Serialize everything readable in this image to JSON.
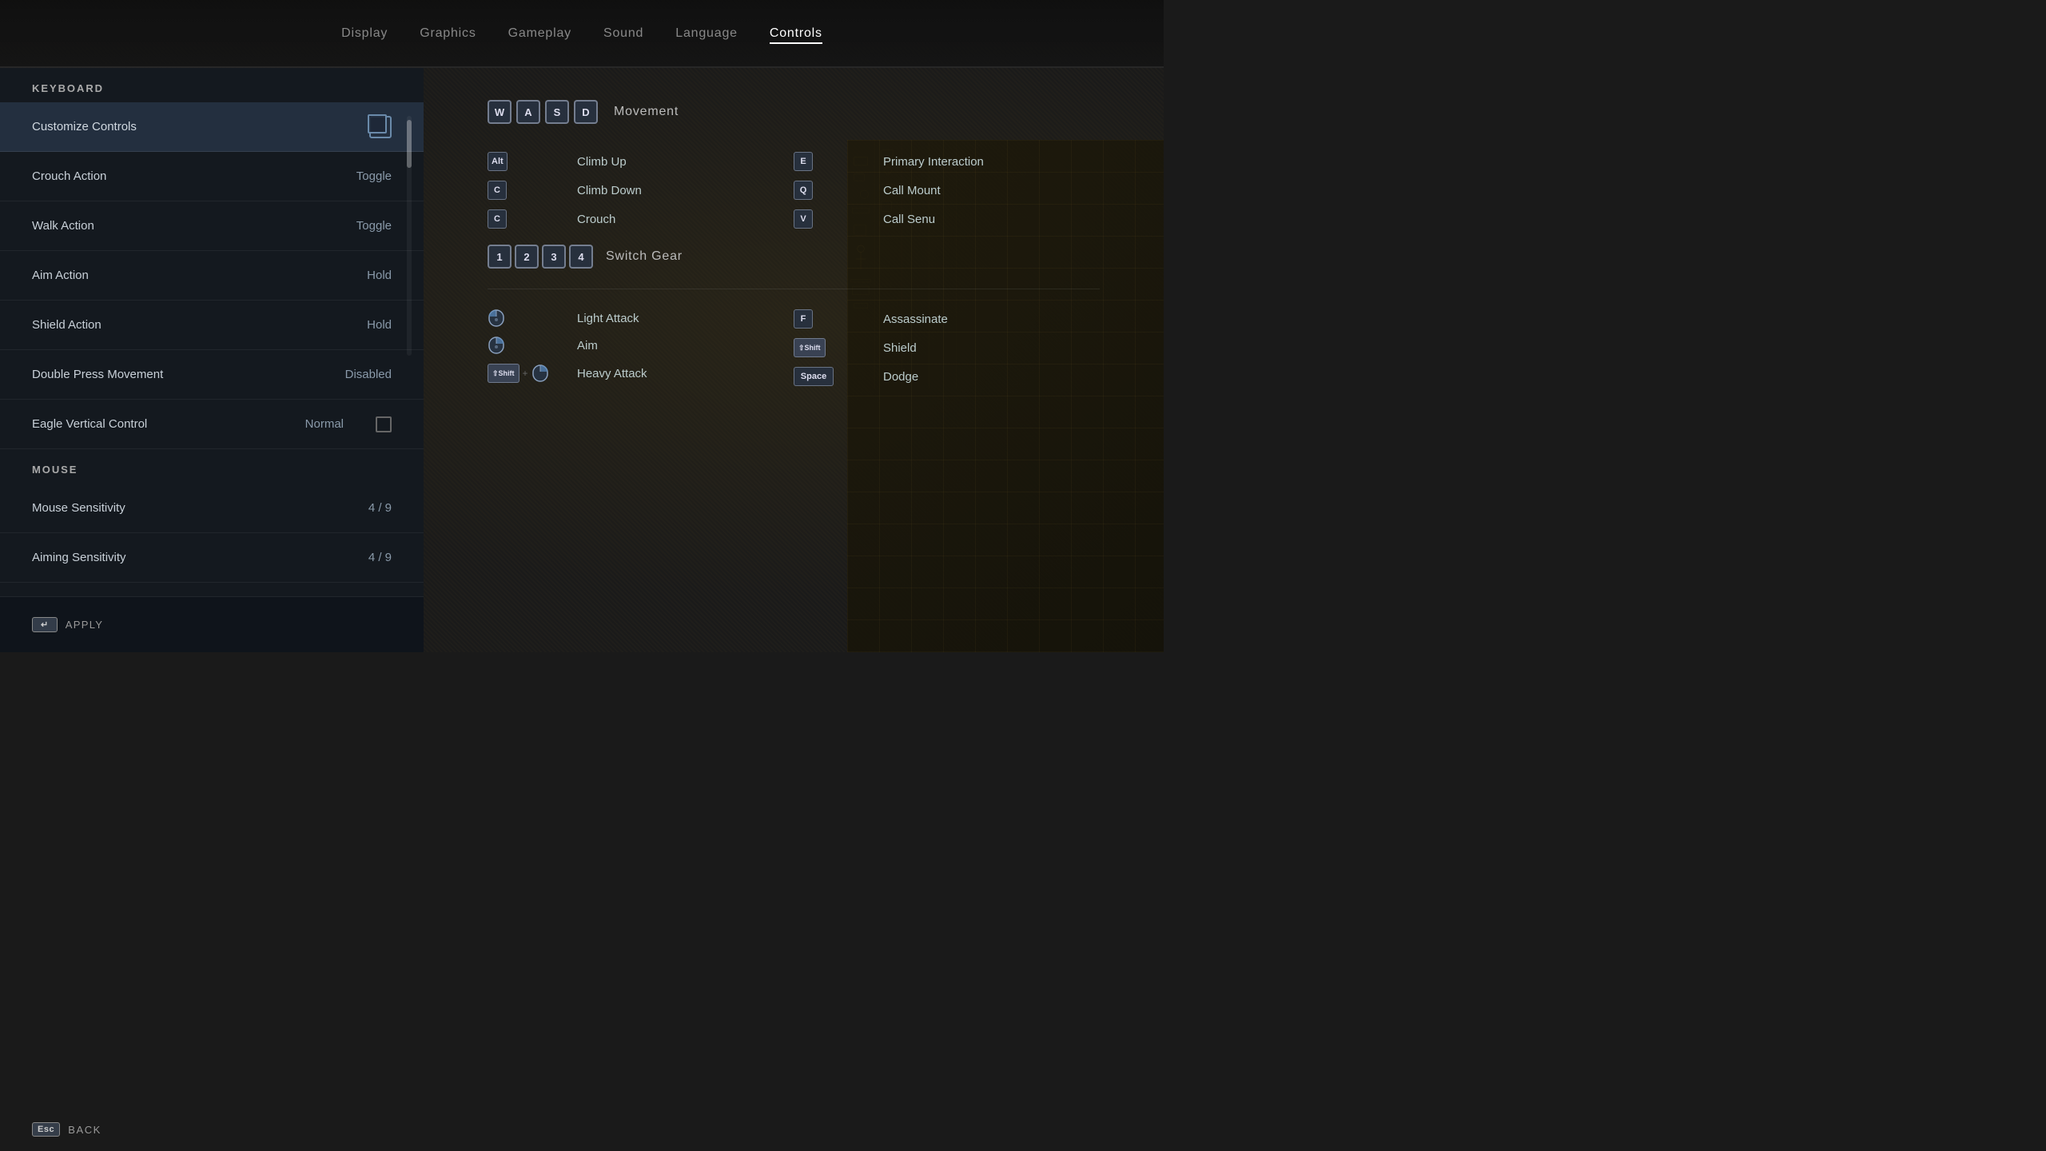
{
  "nav": {
    "items": [
      {
        "id": "display",
        "label": "Display",
        "active": false
      },
      {
        "id": "graphics",
        "label": "Graphics",
        "active": false
      },
      {
        "id": "gameplay",
        "label": "Gameplay",
        "active": false
      },
      {
        "id": "sound",
        "label": "Sound",
        "active": false
      },
      {
        "id": "language",
        "label": "Language",
        "active": false
      },
      {
        "id": "controls",
        "label": "Controls",
        "active": true
      }
    ]
  },
  "keyboard": {
    "section_label": "KEYBOARD",
    "customize_label": "Customize Controls",
    "settings": [
      {
        "id": "crouch_action",
        "label": "Crouch Action",
        "value": "Toggle"
      },
      {
        "id": "walk_action",
        "label": "Walk Action",
        "value": "Toggle"
      },
      {
        "id": "aim_action",
        "label": "Aim Action",
        "value": "Hold"
      },
      {
        "id": "shield_action",
        "label": "Shield Action",
        "value": "Hold"
      },
      {
        "id": "double_press",
        "label": "Double Press Movement",
        "value": "Disabled"
      },
      {
        "id": "eagle_vertical",
        "label": "Eagle Vertical Control",
        "value": "Normal",
        "has_checkbox": true
      }
    ]
  },
  "mouse": {
    "section_label": "MOUSE",
    "settings": [
      {
        "id": "mouse_sensitivity",
        "label": "Mouse Sensitivity",
        "value": "4 / 9"
      },
      {
        "id": "aiming_sensitivity",
        "label": "Aiming Sensitivity",
        "value": "4 / 9"
      }
    ]
  },
  "bottom_bar": {
    "apply_key": "↵",
    "apply_label": "APPLY"
  },
  "back": {
    "key": "Esc",
    "label": "BACK"
  },
  "bindings": {
    "movement_label": "Movement",
    "wasd_keys": [
      "W",
      "A",
      "S",
      "D"
    ],
    "movement_bindings": [
      {
        "keys": [
          "Alt"
        ],
        "action": "Climb Up"
      },
      {
        "keys": [
          "C"
        ],
        "action": "Climb Down"
      },
      {
        "keys": [
          "C"
        ],
        "action": "Crouch"
      }
    ],
    "right_movement_bindings": [
      {
        "keys": [
          "E"
        ],
        "action": "Primary Interaction"
      },
      {
        "keys": [
          "Q"
        ],
        "action": "Call Mount"
      },
      {
        "keys": [
          "V"
        ],
        "action": "Call Senu"
      }
    ],
    "switch_gear_label": "Switch Gear",
    "switch_gear_numbers": [
      "1",
      "2",
      "3",
      "4"
    ],
    "combat_left": [
      {
        "keys": [
          "LMB"
        ],
        "action": "Light Attack",
        "is_mouse": true
      },
      {
        "keys": [
          "RMB"
        ],
        "action": "Aim",
        "is_mouse": true
      },
      {
        "keys": [
          "Shift",
          "RMB"
        ],
        "action": "Heavy Attack",
        "is_mouse": true,
        "has_plus": true
      }
    ],
    "combat_right": [
      {
        "keys": [
          "F"
        ],
        "action": "Assassinate"
      },
      {
        "keys": [
          "Shift"
        ],
        "action": "Shield"
      },
      {
        "keys": [
          "Space"
        ],
        "action": "Dodge"
      }
    ]
  }
}
